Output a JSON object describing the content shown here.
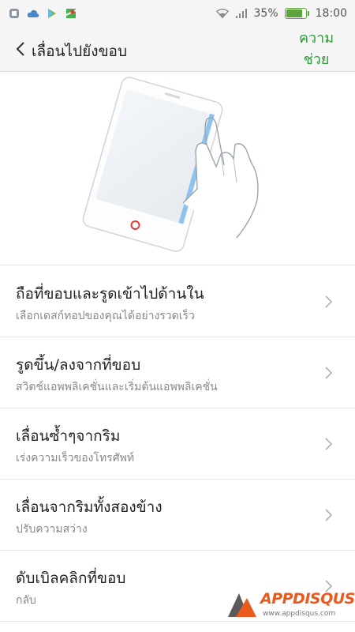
{
  "status_bar": {
    "left_icons": [
      "app-icon",
      "cloud-icon",
      "play-store-icon",
      "maps-icon"
    ],
    "battery_percent_text": "35%",
    "battery_level": 0.9,
    "time": "18:00"
  },
  "header": {
    "back_icon": "chevron-left-icon",
    "title": "เลื่อนไปยังขอบ",
    "help_line1": "ความ",
    "help_line2": "ช่วย"
  },
  "colors": {
    "accent": "#2e9a3a",
    "battery": "#5aa43a",
    "phone_edge": "#8dc3ee"
  },
  "items": [
    {
      "title": "ถือที่ขอบและรูดเข้าไปด้านใน",
      "subtitle": "เลือกเดสก์ทอปของคุณได้อย่างรวดเร็ว"
    },
    {
      "title": "รูดขึ้น/ลงจากที่ขอบ",
      "subtitle": "สวิตช์แอพพลิเคชั่นและเริ่มต้นแอพพลิเคชั่น"
    },
    {
      "title": "เลื่อนซ้ำๆจากริม",
      "subtitle": "เร่งความเร็วของโทรศัพท์"
    },
    {
      "title": "เลื่อนจากริมทั้งสองข้าง",
      "subtitle": "ปรับความสว่าง"
    },
    {
      "title": "ดับเบิลคลิกที่ขอบ",
      "subtitle": "กลับ"
    }
  ],
  "watermark": {
    "brand": "APPDISQUS",
    "url": "www.appdisqus.com"
  }
}
